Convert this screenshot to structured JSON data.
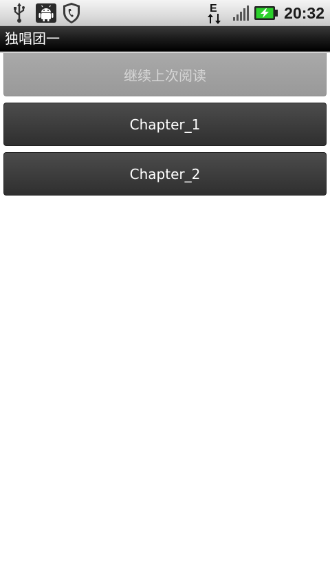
{
  "status_bar": {
    "icons": [
      "usb-icon",
      "android-debug-icon",
      "shield-phone-icon",
      "network-e-icon",
      "signal-icon",
      "battery-charging-icon"
    ],
    "network_label": "E",
    "time": "20:32",
    "colors": {
      "battery": "#2bd12b"
    }
  },
  "app": {
    "title": "独唱团一"
  },
  "buttons": {
    "resume": "继续上次阅读",
    "chapters": [
      "Chapter_1",
      "Chapter_2"
    ]
  }
}
